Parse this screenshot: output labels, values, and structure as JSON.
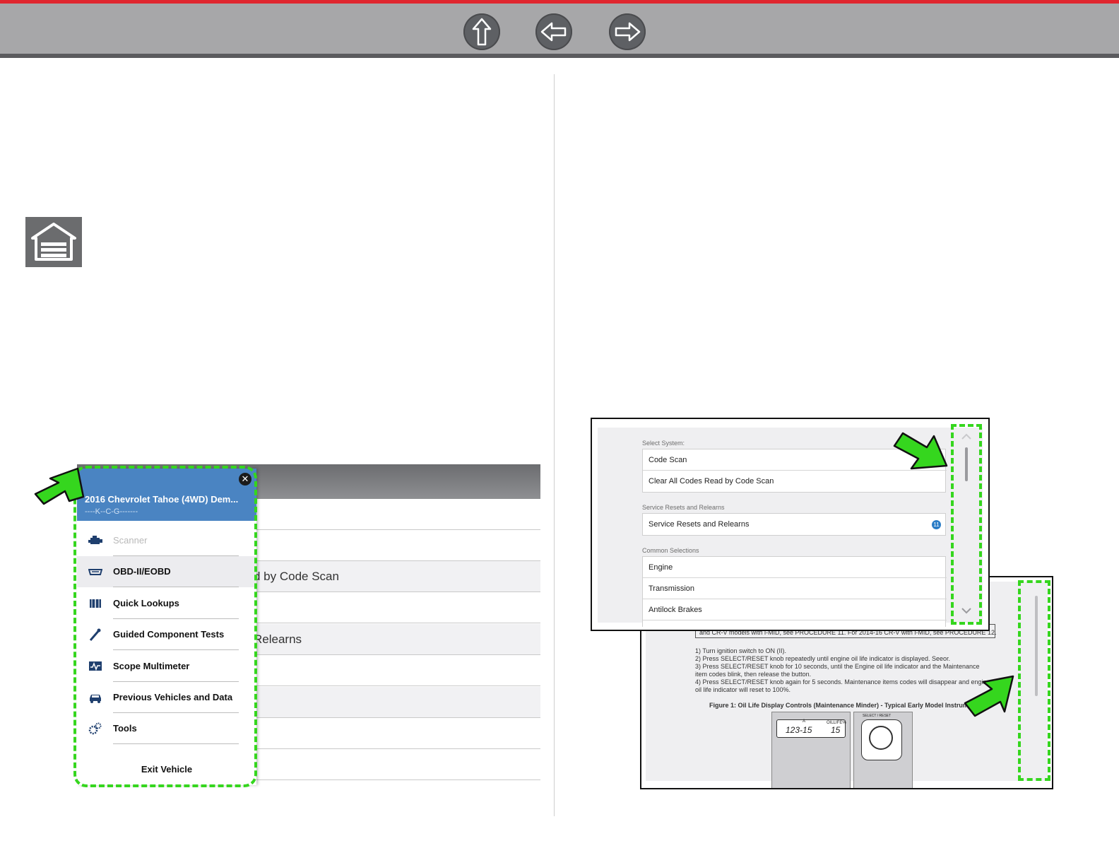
{
  "colors": {
    "accent_red": "#e0262f",
    "highlight_green": "#35d61e",
    "menu_blue": "#4a84c2",
    "nav_button": "#5e6064"
  },
  "toolbar": {
    "buttons": [
      {
        "icon": "up-arrow-icon"
      },
      {
        "icon": "back-arrow-icon"
      },
      {
        "icon": "forward-arrow-icon"
      }
    ]
  },
  "home_icon": "garage-home-icon",
  "left_screenshot": {
    "background_rows": [
      "d by Code Scan",
      "Relearns"
    ],
    "menu": {
      "vehicle_title": "2016 Chevrolet Tahoe (4WD) Dem...",
      "vehicle_code": "----K--C-G-------",
      "items": [
        {
          "label": "Scanner",
          "icon": "engine-icon",
          "state": "disabled"
        },
        {
          "label": "OBD-II/EOBD",
          "icon": "obd-connector-icon",
          "state": "selected"
        },
        {
          "label": "Quick Lookups",
          "icon": "book-icon",
          "state": "normal"
        },
        {
          "label": "Guided Component Tests",
          "icon": "probe-icon",
          "state": "normal"
        },
        {
          "label": "Scope Multimeter",
          "icon": "scope-icon",
          "state": "normal"
        },
        {
          "label": "Previous Vehicles and Data",
          "icon": "vehicle-icon",
          "state": "normal"
        },
        {
          "label": "Tools",
          "icon": "gears-icon",
          "state": "normal"
        }
      ],
      "exit_label": "Exit Vehicle"
    }
  },
  "right_select_screenshot": {
    "sections": [
      {
        "label": "Select System:",
        "items": [
          {
            "label": "Code Scan"
          },
          {
            "label": "Clear All Codes Read by Code Scan"
          }
        ]
      },
      {
        "label": "Service Resets and Relearns",
        "items": [
          {
            "label": "Service Resets and Relearns",
            "badge": "11"
          }
        ]
      },
      {
        "label": "Common Selections",
        "items": [
          {
            "label": "Engine"
          },
          {
            "label": "Transmission"
          },
          {
            "label": "Antilock Brakes"
          }
        ]
      }
    ]
  },
  "right_doc_screenshot": {
    "lines": [
      "and CR-V models with i-MID, see PROCEDURE 11. For 2014-16 CR-V with i-MID, see PROCEDURE 12.",
      "1) Turn ignition switch to ON (II).",
      "2) Press SELECT/RESET knob repeatedly until engine oil life indicator is displayed. Seeor.",
      "3) Press SELECT/RESET knob for 10 seconds, until the Engine oil life indicator and the Maintenance",
      "item codes blink, then release the button.",
      "4) Press SELECT/RESET knob again for 5 seconds. Maintenance items codes will disappear and engine",
      "oil life indicator will reset to 100%."
    ],
    "figure_caption": "Figure 1: Oil Life Display Controls (Maintenance Minder) - Typical Early Model Instrument",
    "display_reading": "123-15",
    "oil_life_label": "OILLIFE%",
    "oil_life_value": "15",
    "trip_label": "A",
    "knob_label": "SELECT / RESET"
  }
}
